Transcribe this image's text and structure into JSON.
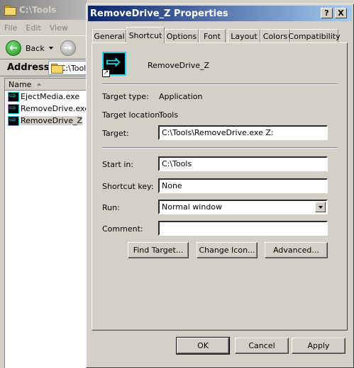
{
  "explorer": {
    "title": "C:\\Tools",
    "menu": [
      "File",
      "Edit",
      "View"
    ],
    "back_label": "Back",
    "address_label": "Address",
    "address_value": "C:\\Tools",
    "column_header": "Name",
    "files": [
      {
        "name": "EjectMedia.exe"
      },
      {
        "name": "RemoveDrive.exe"
      },
      {
        "name": "RemoveDrive_Z"
      }
    ]
  },
  "dialog": {
    "title": "RemoveDrive_Z Properties",
    "help_glyph": "?",
    "close_glyph": "X",
    "tabs": [
      "General",
      "Shortcut",
      "Options",
      "Font",
      "Layout",
      "Colors",
      "Compatibility"
    ],
    "active_tab": "Shortcut",
    "shortcut_name": "RemoveDrive_Z",
    "fields": {
      "target_type_label": "Target type:",
      "target_type_value": "Application",
      "target_location_label": "Target location:",
      "target_location_value": "Tools",
      "target_label": "Target:",
      "target_value": "C:\\Tools\\RemoveDrive.exe Z:",
      "start_in_label": "Start in:",
      "start_in_value": "C:\\Tools",
      "shortcut_key_label": "Shortcut key:",
      "shortcut_key_value": "None",
      "run_label": "Run:",
      "run_value": "Normal window",
      "comment_label": "Comment:",
      "comment_value": ""
    },
    "buttons": {
      "find_target": "Find Target...",
      "change_icon": "Change Icon...",
      "advanced": "Advanced...",
      "ok": "OK",
      "cancel": "Cancel",
      "apply": "Apply"
    }
  }
}
